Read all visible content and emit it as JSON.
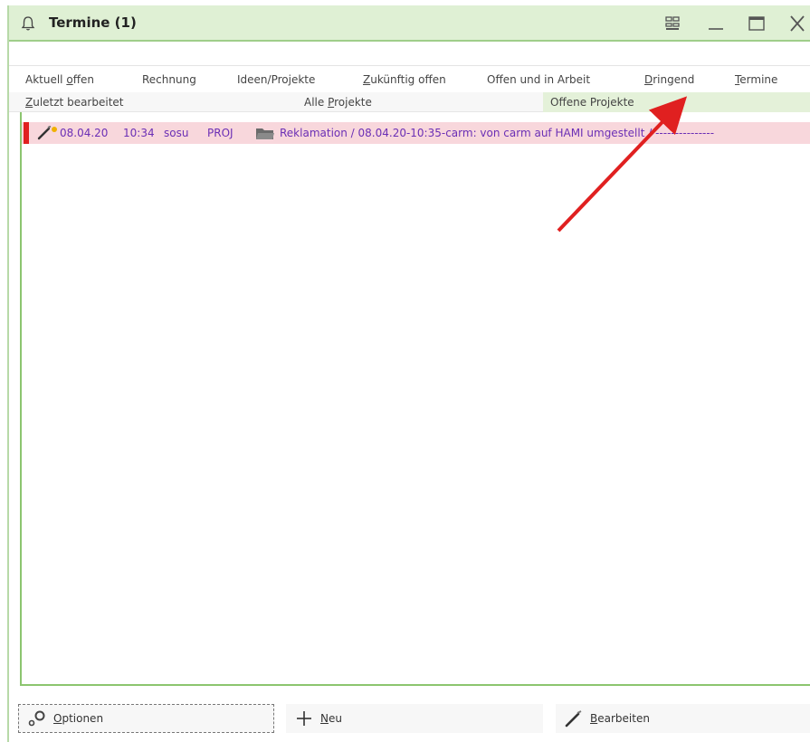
{
  "window": {
    "title": "Termine (1)",
    "icons": {
      "bell": "bell-icon",
      "layout": "layout-grid-icon",
      "minimize": "minimize-icon",
      "maximize": "maximize-icon",
      "close": "close-icon"
    }
  },
  "tabs_row1": [
    {
      "pre": "Aktuell ",
      "u": "o",
      "post": "ffen"
    },
    {
      "pre": "Rechnung",
      "u": "",
      "post": ""
    },
    {
      "pre": "Ideen/Projekte",
      "u": "",
      "post": ""
    },
    {
      "pre": "",
      "u": "Z",
      "post": "ukünftig offen"
    },
    {
      "pre": "Offen und in Arbeit",
      "u": "",
      "post": ""
    },
    {
      "pre": "",
      "u": "D",
      "post": "ringend"
    },
    {
      "pre": "",
      "u": "T",
      "post": "ermine"
    }
  ],
  "tabs_row2": [
    {
      "pre": "",
      "u": "Z",
      "post": "uletzt bearbeitet"
    },
    {
      "pre": "Alle ",
      "u": "P",
      "post": "rojekte"
    },
    {
      "pre": "Offene Projekte",
      "u": "",
      "post": ""
    }
  ],
  "active_tab": "Offene Projekte",
  "list": {
    "rows": [
      {
        "date": "08.04.20",
        "time": "10:34",
        "user": "sosu",
        "type": "PROJ",
        "text": "Reklamation / 08.04.20-10:35-carm: von carm auf HAMI umgestellt / ---------------",
        "flag_color": "#e02020",
        "icons": [
          "pencil-icon",
          "star-icon",
          "folder-icon"
        ]
      }
    ]
  },
  "buttons": {
    "optionen": {
      "u": "O",
      "post": "ptionen"
    },
    "neu": {
      "u": "N",
      "post": "eu"
    },
    "bearbeiten": {
      "u": "B",
      "post": "earbeiten"
    }
  },
  "colors": {
    "titlebar": "#dff0d4",
    "accent_green": "#8cc56f",
    "row_highlight": "#f8d7dc",
    "row_text": "#6b2fb5",
    "annotation_arrow": "#e02020"
  }
}
